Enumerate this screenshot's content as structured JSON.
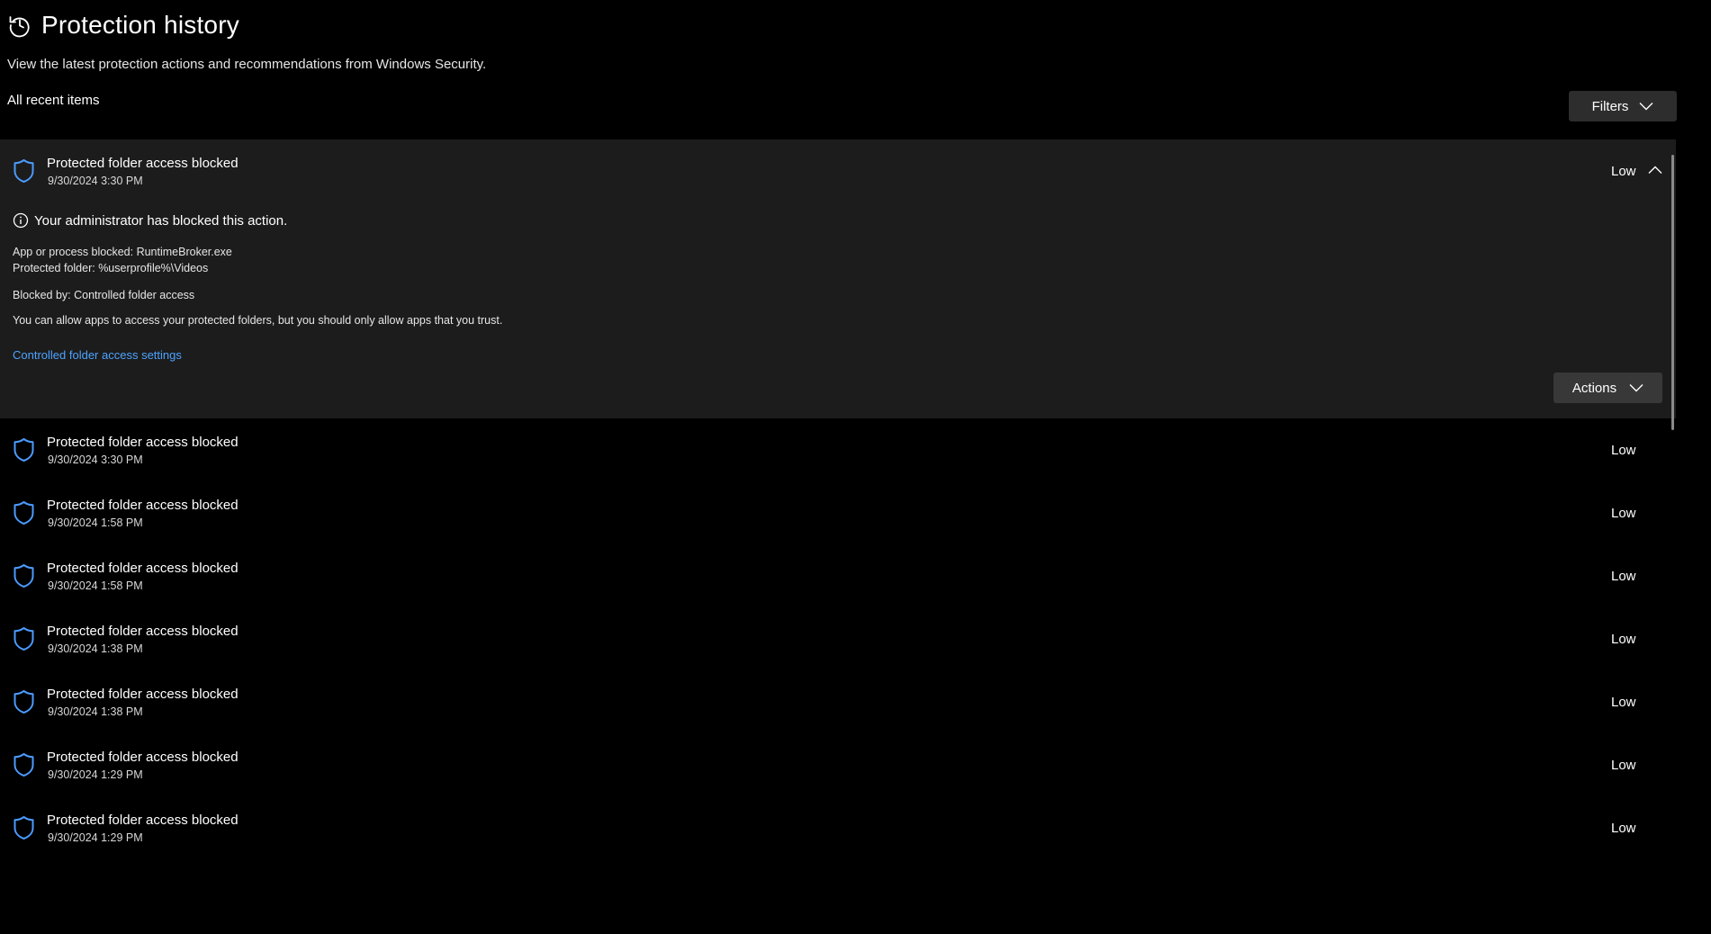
{
  "header": {
    "title": "Protection history",
    "subtitle": "View the latest protection actions and recommendations from Windows Security.",
    "history_icon": "history-icon"
  },
  "list_header": {
    "label": "All recent items",
    "filters_label": "Filters"
  },
  "expanded_item": {
    "title": "Protected folder access blocked",
    "date": "9/30/2024 3:30 PM",
    "severity": "Low",
    "notice": "Your administrator has blocked this action.",
    "app_line": "App or process blocked: RuntimeBroker.exe",
    "folder_line": "Protected folder:  %userprofile%\\Videos",
    "blocked_by_line": "Blocked by:  Controlled folder access",
    "advice": "You can allow apps to access your protected folders, but you should only allow apps that you trust.",
    "link_label": "Controlled folder access settings",
    "actions_label": "Actions"
  },
  "items": [
    {
      "title": "Protected folder access blocked",
      "date": "9/30/2024 3:30 PM",
      "severity": "Low"
    },
    {
      "title": "Protected folder access blocked",
      "date": "9/30/2024 1:58 PM",
      "severity": "Low"
    },
    {
      "title": "Protected folder access blocked",
      "date": "9/30/2024 1:58 PM",
      "severity": "Low"
    },
    {
      "title": "Protected folder access blocked",
      "date": "9/30/2024 1:38 PM",
      "severity": "Low"
    },
    {
      "title": "Protected folder access blocked",
      "date": "9/30/2024 1:38 PM",
      "severity": "Low"
    },
    {
      "title": "Protected folder access blocked",
      "date": "9/30/2024 1:29 PM",
      "severity": "Low"
    },
    {
      "title": "Protected folder access blocked",
      "date": "9/30/2024 1:29 PM",
      "severity": "Low"
    }
  ],
  "colors": {
    "background": "#000000",
    "expanded_background": "#1c1c1c",
    "shield_accent": "#4c9bff",
    "link": "#4da3ff"
  }
}
